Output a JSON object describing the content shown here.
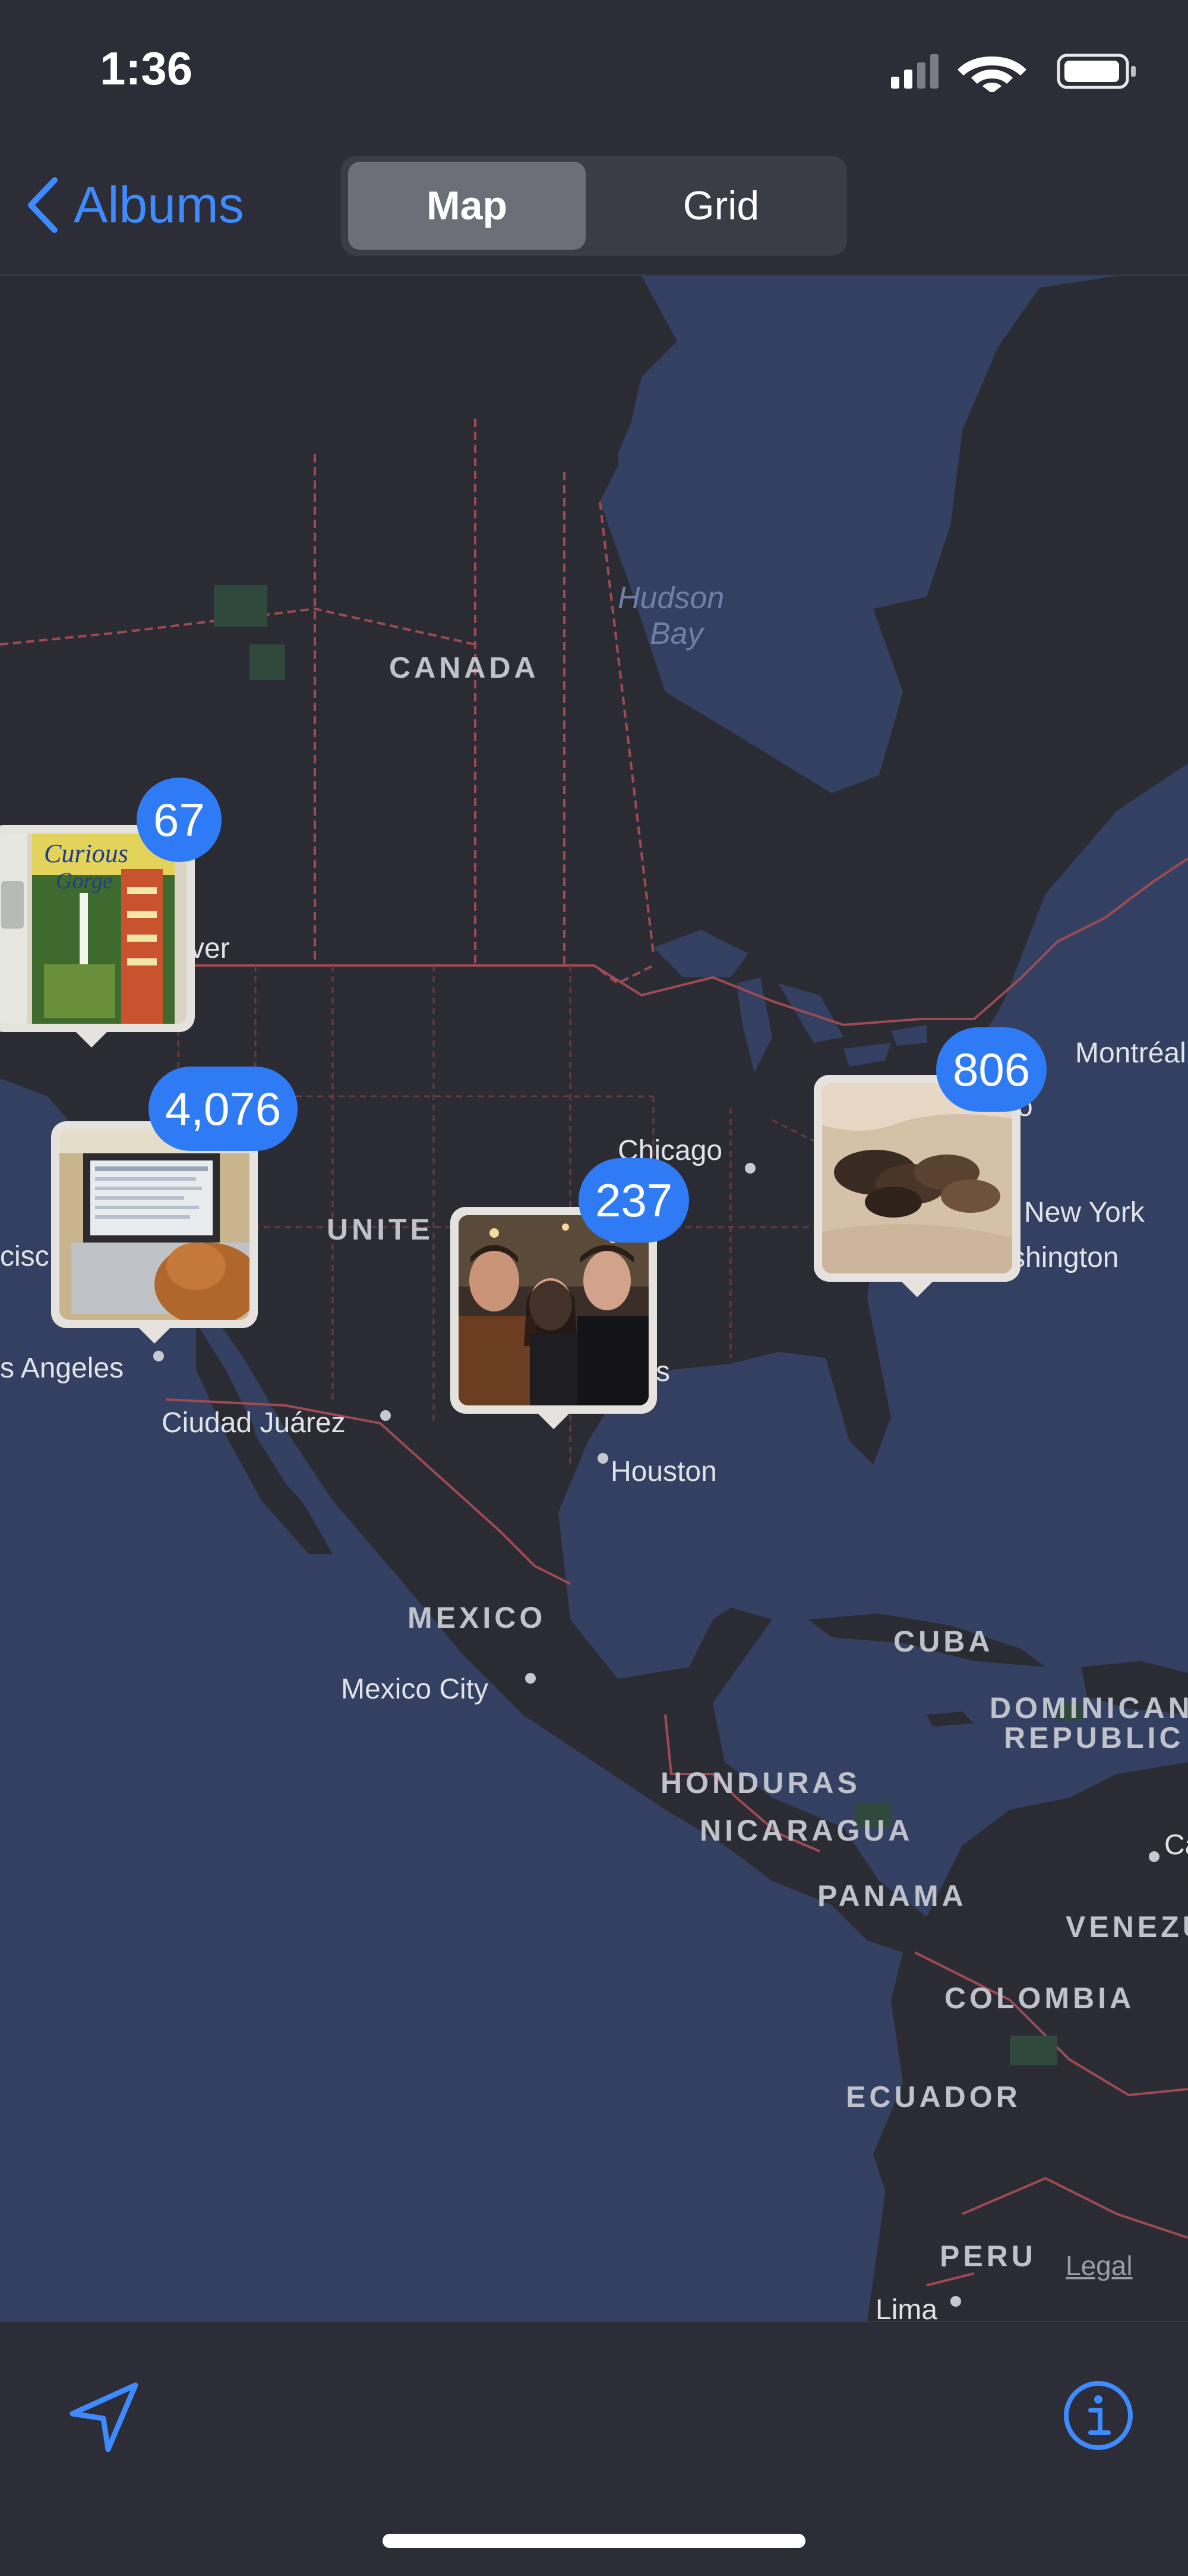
{
  "status_bar": {
    "time": "1:36",
    "icons": [
      "cellular-signal-icon",
      "wifi-icon",
      "battery-icon"
    ]
  },
  "nav": {
    "back_label": "Albums",
    "segments": [
      {
        "label": "Map",
        "selected": true
      },
      {
        "label": "Grid",
        "selected": false
      }
    ]
  },
  "map": {
    "country_labels": {
      "canada": "CANADA",
      "united_states": "UNITE",
      "mexico": "MEXICO",
      "cuba": "CUBA",
      "dominican_republic_line1": "DOMINICAN",
      "dominican_republic_line2": "REPUBLIC",
      "honduras": "HONDURAS",
      "nicaragua": "NICARAGUA",
      "panama": "PANAMA",
      "venezuela": "VENEZU",
      "colombia": "COLOMBIA",
      "ecuador": "ECUADOR",
      "peru": "PERU"
    },
    "water_labels": {
      "hudson_line1": "Hudson",
      "hudson_line2": "Bay"
    },
    "city_labels": {
      "vancouver": "ver",
      "chicago": "Chicago",
      "montreal": "Montréal",
      "montreal_fragment": "o",
      "new_york": "New York",
      "washington": "shington",
      "san_francisco": "cisc",
      "los_angeles": "s Angeles",
      "ciudad_juarez": "Ciudad Juárez",
      "dallas_fragment": "s",
      "houston": "Houston",
      "mexico_city": "Mexico City",
      "caracas_fragment": "Ca",
      "lima": "Lima"
    },
    "legal_link": "Legal",
    "clusters": [
      {
        "id": "pacific-northwest",
        "count": "67",
        "photo": "guidebook-photo"
      },
      {
        "id": "california",
        "count": "4,076",
        "photo": "laptop-dog-photo"
      },
      {
        "id": "texas",
        "count": "237",
        "photo": "group-selfie-photo"
      },
      {
        "id": "east-coast",
        "count": "806",
        "photo": "puppies-photo"
      }
    ]
  },
  "toolbar": {
    "left_icon": "location-arrow-icon",
    "right_icon": "info-icon"
  },
  "colors": {
    "accent": "#3d8bff",
    "badge": "#2f7bf6",
    "land": "#2b2c33",
    "water": "#334062",
    "border": "#9e4a52"
  }
}
